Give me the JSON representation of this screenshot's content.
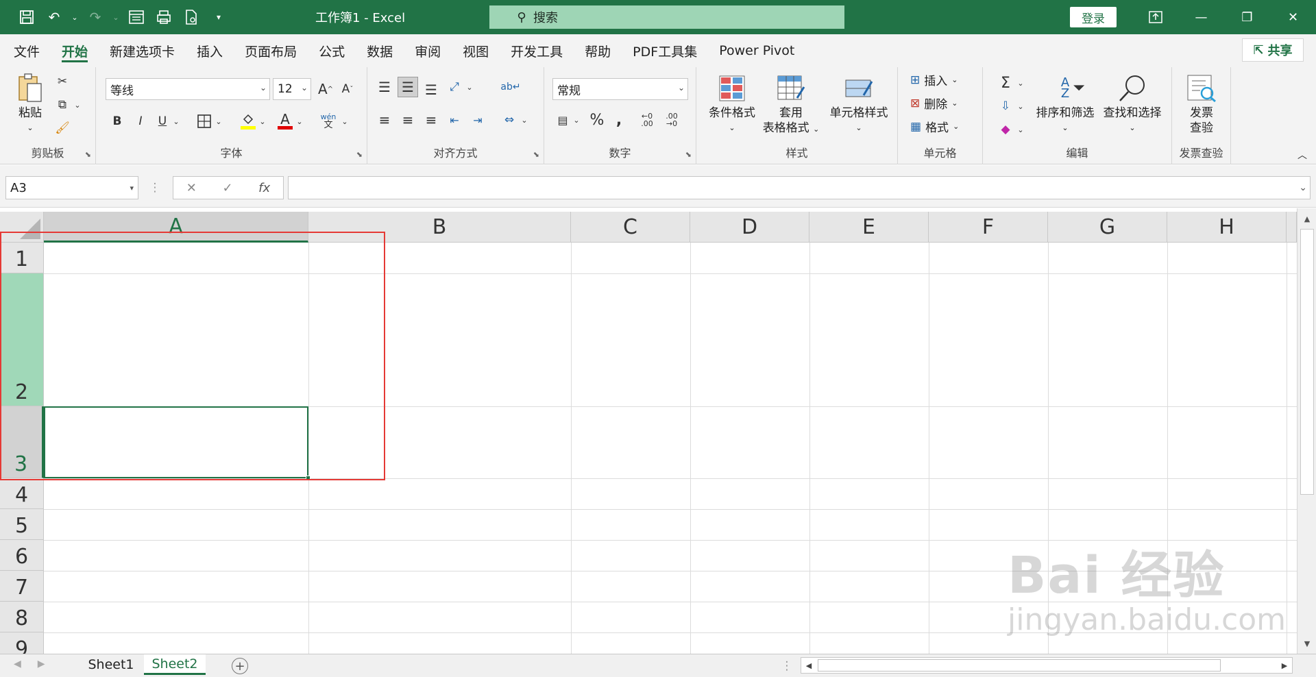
{
  "window": {
    "title": "工作簿1  -  Excel",
    "search_placeholder": "搜索",
    "login_label": "登录"
  },
  "ribbon_tabs": [
    "文件",
    "开始",
    "新建选项卡",
    "插入",
    "页面布局",
    "公式",
    "数据",
    "审阅",
    "视图",
    "开发工具",
    "帮助",
    "PDF工具集",
    "Power Pivot"
  ],
  "active_tab": "开始",
  "share_label": "共享",
  "groups": {
    "clipboard": {
      "label": "剪贴板",
      "paste": "粘贴"
    },
    "font": {
      "label": "字体",
      "font_name": "等线",
      "font_size": "12"
    },
    "alignment": {
      "label": "对齐方式"
    },
    "number": {
      "label": "数字",
      "format": "常规"
    },
    "styles": {
      "label": "样式",
      "cond_format": "条件格式",
      "table_format_1": "套用",
      "table_format_2": "表格格式",
      "cell_style": "单元格样式"
    },
    "cells": {
      "label": "单元格",
      "insert": "插入",
      "delete": "删除",
      "format": "格式"
    },
    "editing": {
      "label": "编辑",
      "sort_filter": "排序和筛选",
      "find_select": "查找和选择"
    },
    "invoice": {
      "label": "发票查验",
      "btn1": "发票",
      "btn2": "查验"
    }
  },
  "formula_bar": {
    "name_box": "A3",
    "fx": "fx",
    "formula": ""
  },
  "columns": [
    "A",
    "B",
    "C",
    "D",
    "E",
    "F",
    "G",
    "H"
  ],
  "rows": [
    "1",
    "2",
    "3",
    "4",
    "5",
    "6",
    "7",
    "8",
    "9"
  ],
  "selected_cell": "A3",
  "sheets": [
    "Sheet1",
    "Sheet2"
  ],
  "active_sheet": "Sheet2",
  "watermark": {
    "line1": "Bai 经验",
    "line2": "jingyan.baidu.com"
  },
  "colors": {
    "excel_green": "#217346",
    "highlight_row": "#a0d8b8",
    "red_annotation": "#e53935"
  }
}
